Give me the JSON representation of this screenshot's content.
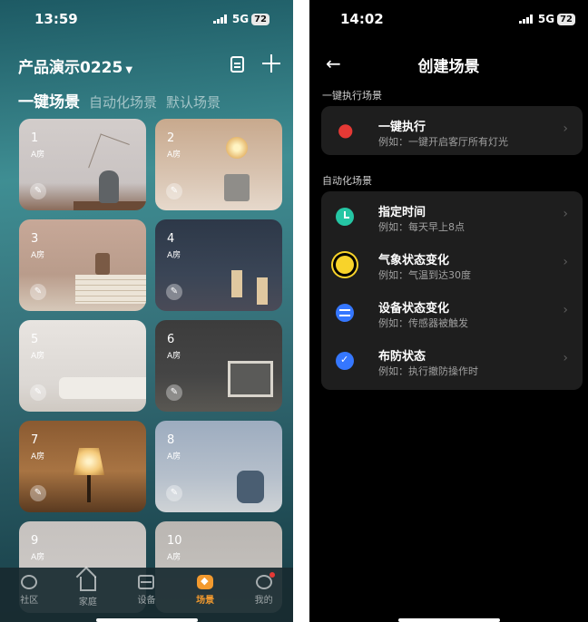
{
  "left": {
    "status": {
      "time": "13:59",
      "network": "5G",
      "battery": "72"
    },
    "header": {
      "home_name": "产品演示0225"
    },
    "tabs": [
      {
        "label": "一键场景",
        "active": true
      },
      {
        "label": "自动化场景",
        "active": false
      },
      {
        "label": "默认场景",
        "active": false
      }
    ],
    "scenes": [
      {
        "num": "1",
        "room": "A房"
      },
      {
        "num": "2",
        "room": "A房"
      },
      {
        "num": "3",
        "room": "A房"
      },
      {
        "num": "4",
        "room": "A房"
      },
      {
        "num": "5",
        "room": "A房"
      },
      {
        "num": "6",
        "room": "A房"
      },
      {
        "num": "7",
        "room": "A房"
      },
      {
        "num": "8",
        "room": "A房"
      },
      {
        "num": "9",
        "room": "A房"
      },
      {
        "num": "10",
        "room": "A房"
      }
    ],
    "nav": [
      {
        "label": "社区",
        "icon": "community-icon"
      },
      {
        "label": "家庭",
        "icon": "home-icon"
      },
      {
        "label": "设备",
        "icon": "device-icon"
      },
      {
        "label": "场景",
        "icon": "scene-icon",
        "active": true
      },
      {
        "label": "我的",
        "icon": "profile-icon"
      }
    ],
    "colors": {
      "accent": "#f39a2e"
    }
  },
  "right": {
    "status": {
      "time": "14:02",
      "network": "5G",
      "battery": "72"
    },
    "header": {
      "title": "创建场景"
    },
    "sections": [
      {
        "label": "一键执行场景",
        "items": [
          {
            "title": "一键执行",
            "subtitle": "例如：一键开启客厅所有灯光",
            "icon": "touch-icon"
          }
        ]
      },
      {
        "label": "自动化场景",
        "items": [
          {
            "title": "指定时间",
            "subtitle": "例如：每天早上8点",
            "icon": "clock-icon"
          },
          {
            "title": "气象状态变化",
            "subtitle": "例如：气温到达30度",
            "icon": "sun-icon"
          },
          {
            "title": "设备状态变化",
            "subtitle": "例如：传感器被触发",
            "icon": "device-icon"
          },
          {
            "title": "布防状态",
            "subtitle": "例如：执行撤防操作时",
            "icon": "shield-icon"
          }
        ]
      }
    ]
  }
}
